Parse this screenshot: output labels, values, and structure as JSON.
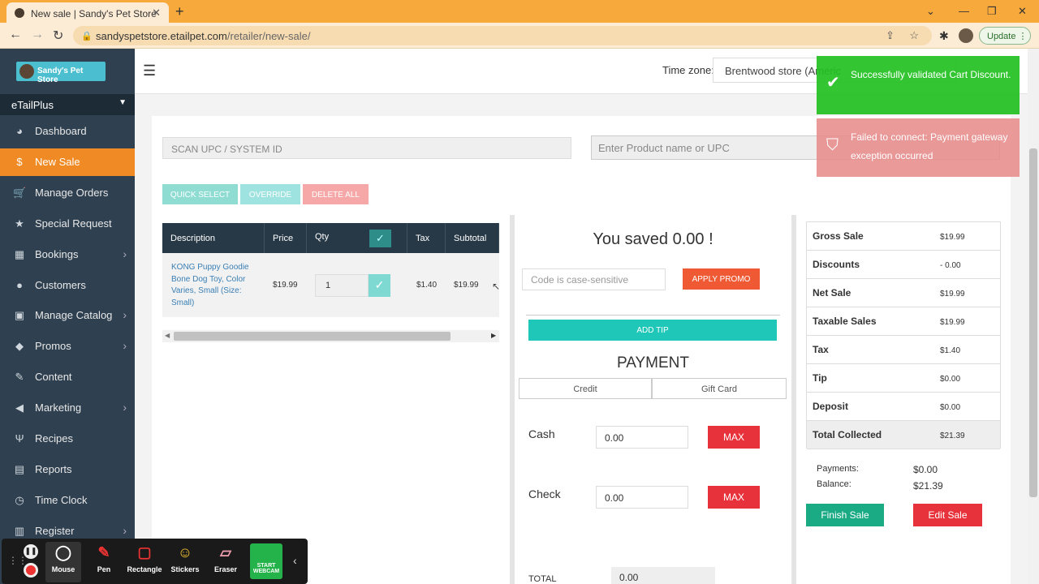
{
  "browser": {
    "tab_title": "New sale | Sandy's Pet Store",
    "url_host": "sandyspetstore.etailpet.com",
    "url_path": "/retailer/new-sale/",
    "update_label": "Update"
  },
  "sidebar": {
    "logo_text": "Sandy's Pet Store",
    "brand": "eTailPlus",
    "items": [
      {
        "label": "Dashboard",
        "icon": "gauge-icon",
        "glyph": "◕"
      },
      {
        "label": "New Sale",
        "icon": "dollar-icon",
        "glyph": "$"
      },
      {
        "label": "Manage Orders",
        "icon": "cart-icon",
        "glyph": "🛒"
      },
      {
        "label": "Special Request",
        "icon": "star-icon",
        "glyph": "★"
      },
      {
        "label": "Bookings",
        "icon": "calendar-icon",
        "glyph": "▦"
      },
      {
        "label": "Customers",
        "icon": "user-icon",
        "glyph": "●"
      },
      {
        "label": "Manage Catalog",
        "icon": "box-icon",
        "glyph": "▣"
      },
      {
        "label": "Promos",
        "icon": "tag-icon",
        "glyph": "◆"
      },
      {
        "label": "Content",
        "icon": "edit-icon",
        "glyph": "✎"
      },
      {
        "label": "Marketing",
        "icon": "megaphone-icon",
        "glyph": "◀"
      },
      {
        "label": "Recipes",
        "icon": "utensils-icon",
        "glyph": "Ψ"
      },
      {
        "label": "Reports",
        "icon": "file-icon",
        "glyph": "▤"
      },
      {
        "label": "Time Clock",
        "icon": "clock-icon",
        "glyph": "◷"
      },
      {
        "label": "Register",
        "icon": "register-icon",
        "glyph": "▥"
      }
    ]
  },
  "header": {
    "timezone_label": "Time zone:",
    "timezone_value": "Brentwood store (Americ"
  },
  "search": {
    "scan_placeholder": "SCAN UPC / SYSTEM ID",
    "product_placeholder": "Enter Product name or UPC"
  },
  "actions": {
    "quick_select": "QUICK SELECT",
    "override": "OVERRIDE",
    "delete_all": "DELETE ALL"
  },
  "cart": {
    "headers": [
      "Description",
      "Price",
      "Qty",
      "Tax",
      "Subtotal"
    ],
    "row": {
      "description": "KONG Puppy Goodie Bone Dog Toy, Color Varies, Small (Size: Small)",
      "price": "$19.99",
      "qty": "1",
      "tax": "$1.40",
      "subtotal": "$19.99"
    }
  },
  "checkout": {
    "saved": "You saved 0.00 !",
    "promo_placeholder": "Code is case-sensitive",
    "apply_promo": "APPLY PROMO",
    "add_tip": "ADD TIP",
    "payment_title": "PAYMENT",
    "tabs": [
      "Credit",
      "Gift Card"
    ],
    "cash_label": "Cash",
    "cash_value": "0.00",
    "check_label": "Check",
    "check_value": "0.00",
    "max_label": "MAX",
    "total_label": "TOTAL",
    "total_value": "0.00"
  },
  "summary": {
    "rows": [
      {
        "k": "Gross Sale",
        "v": "$19.99"
      },
      {
        "k": "Discounts",
        "v": "- 0.00"
      },
      {
        "k": "Net Sale",
        "v": "$19.99"
      },
      {
        "k": "Taxable Sales",
        "v": "$19.99"
      },
      {
        "k": "Tax",
        "v": "$1.40"
      },
      {
        "k": "Tip",
        "v": "$0.00"
      },
      {
        "k": "Deposit",
        "v": "$0.00"
      },
      {
        "k": "Total Collected",
        "v": "$21.39"
      }
    ],
    "payments_label": "Payments:",
    "payments_value": "$0.00",
    "balance_label": "Balance:",
    "balance_value": "$21.39",
    "finish": "Finish Sale",
    "edit": "Edit Sale"
  },
  "toasts": {
    "success": "Successfully validated Cart Discount.",
    "error": "Failed to connect: Payment gateway exception occurred"
  },
  "recorder": {
    "tools": [
      "Mouse",
      "Pen",
      "Rectangle",
      "Stickers",
      "Eraser"
    ],
    "webcam": "START WEBCAM"
  },
  "colors": {
    "accent": "#f08a24",
    "sidebar": "#2f4050",
    "teal": "#1fc7b8",
    "danger": "#e8323b",
    "success": "#1bab84"
  }
}
